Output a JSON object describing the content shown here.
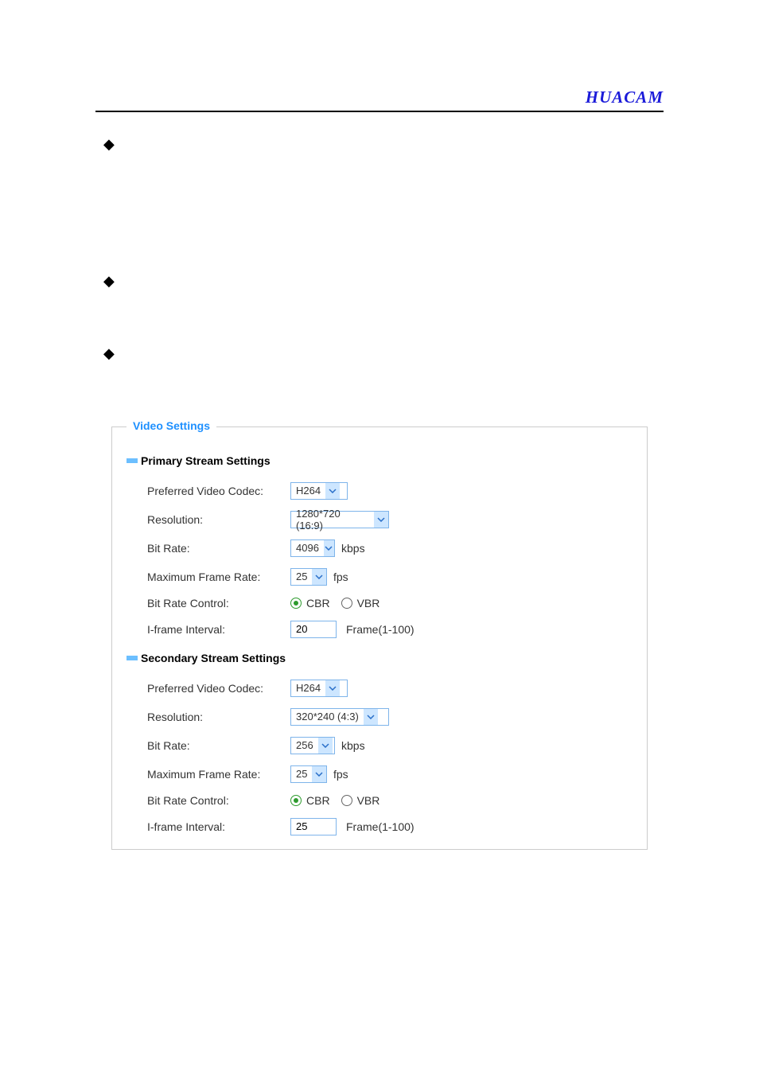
{
  "header": {
    "brand": "HUACAM"
  },
  "bullets": {
    "b1": "◆",
    "b2": "◆",
    "b3": "◆"
  },
  "fieldset": {
    "legend": "Video Settings",
    "primary": {
      "title": "Primary Stream Settings",
      "codec": {
        "label": "Preferred Video Codec:",
        "value": "H264"
      },
      "resolution": {
        "label": "Resolution:",
        "value": "1280*720 (16:9)"
      },
      "bitrate": {
        "label": "Bit Rate:",
        "value": "4096",
        "unit": "kbps"
      },
      "fps": {
        "label": "Maximum Frame Rate:",
        "value": "25",
        "unit": "fps"
      },
      "brc": {
        "label": "Bit Rate Control:",
        "cbr": "CBR",
        "vbr": "VBR"
      },
      "iframe": {
        "label": "I-frame Interval:",
        "value": "20",
        "suffix": "Frame(1-100)"
      }
    },
    "secondary": {
      "title": "Secondary Stream Settings",
      "codec": {
        "label": "Preferred Video Codec:",
        "value": "H264"
      },
      "resolution": {
        "label": "Resolution:",
        "value": "320*240 (4:3)"
      },
      "bitrate": {
        "label": "Bit Rate:",
        "value": "256",
        "unit": "kbps"
      },
      "fps": {
        "label": "Maximum Frame Rate:",
        "value": "25",
        "unit": "fps"
      },
      "brc": {
        "label": "Bit Rate Control:",
        "cbr": "CBR",
        "vbr": "VBR"
      },
      "iframe": {
        "label": "I-frame Interval:",
        "value": "25",
        "suffix": "Frame(1-100)"
      }
    }
  }
}
